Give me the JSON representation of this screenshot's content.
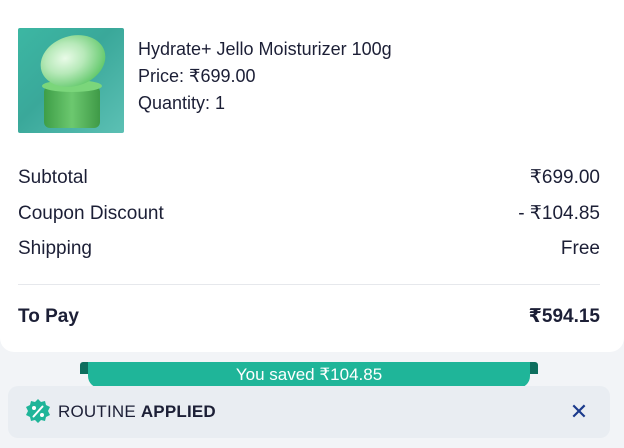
{
  "product": {
    "name": "Hydrate+ Jello Moisturizer 100g",
    "price": "Price: ₹699.00",
    "quantity": "Quantity: 1"
  },
  "summary": {
    "subtotal_label": "Subtotal",
    "subtotal_value": "₹699.00",
    "coupon_label": "Coupon Discount",
    "coupon_value": "- ₹104.85",
    "shipping_label": "Shipping",
    "shipping_value": "Free",
    "total_label": "To Pay",
    "total_value": "₹594.15"
  },
  "savings": {
    "text": "You saved ₹104.85"
  },
  "routine": {
    "prefix": "ROUTINE ",
    "status": "APPLIED",
    "close_symbol": "✕",
    "icon": "discount-badge-icon"
  },
  "colors": {
    "accent_green": "#1fb599",
    "dark_green": "#0d6e5e",
    "close_blue": "#1b3a8c"
  }
}
